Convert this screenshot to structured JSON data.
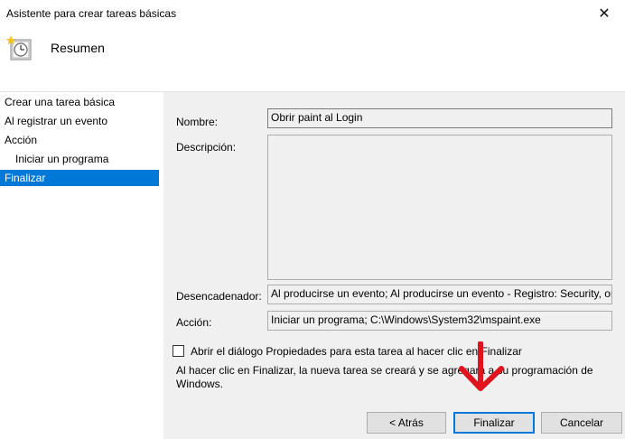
{
  "window": {
    "title": "Asistente para crear tareas básicas",
    "close_glyph": "✕"
  },
  "header": {
    "title": "Resumen",
    "icon": "clock-task-icon"
  },
  "sidebar": {
    "items": [
      {
        "label": "Crear una tarea básica"
      },
      {
        "label": "Al registrar un evento"
      },
      {
        "label": "Acción"
      },
      {
        "label": "Iniciar un programa"
      },
      {
        "label": "Finalizar"
      }
    ]
  },
  "form": {
    "name_label": "Nombre:",
    "name_value": "Obrir paint al Login",
    "description_label": "Descripción:",
    "description_value": "",
    "trigger_label": "Desencadenador:",
    "trigger_value": "Al producirse un evento; Al producirse un evento - Registro: Security, or",
    "action_label": "Acción:",
    "action_value": "Iniciar un programa; C:\\Windows\\System32\\mspaint.exe",
    "checkbox_label": "Abrir el diálogo Propiedades para esta tarea al hacer clic en Finalizar",
    "note": "Al hacer clic en Finalizar, la nueva tarea se creará y se agregará a su programación de Windows."
  },
  "buttons": {
    "back": "< Atrás",
    "finish": "Finalizar",
    "cancel": "Cancelar"
  },
  "colors": {
    "accent": "#0078d7",
    "annotation_arrow": "#e0141e"
  }
}
